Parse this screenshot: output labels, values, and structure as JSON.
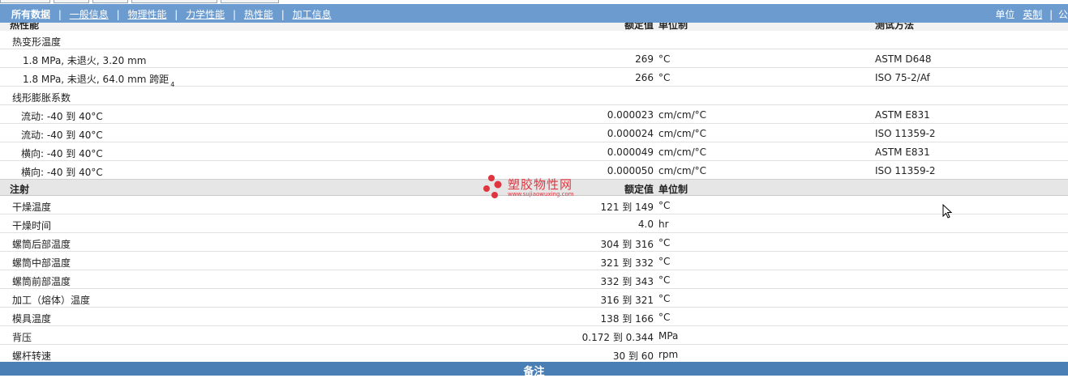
{
  "nav": {
    "all_data": "所有数据",
    "links": [
      "一般信息",
      "物理性能",
      "力学性能",
      "热性能",
      "加工信息"
    ],
    "unit_label": "单位",
    "unit_option": "英制",
    "unit_tail": "公"
  },
  "hidden_header": {
    "name": "热性能",
    "value": "额定值",
    "unit": "单位制",
    "method": "测试方法"
  },
  "thermal_rows": [
    {
      "name": "热变形温度",
      "value": "",
      "unit": "",
      "method": "",
      "level": 0
    },
    {
      "name": "1.8 MPa, 未退火, 3.20 mm",
      "value": "269",
      "unit": "°C",
      "method": "ASTM D648",
      "level": 1
    },
    {
      "name": "1.8 MPa, 未退火, 64.0 mm 跨距",
      "sup": "4",
      "value": "266",
      "unit": "°C",
      "method": "ISO 75-2/Af",
      "level": 1
    },
    {
      "name": "线形膨胀系数",
      "value": "",
      "unit": "",
      "method": "",
      "level": 0
    },
    {
      "name": "流动: -40 到  40°C",
      "value": "0.000023",
      "unit": "cm/cm/°C",
      "method": "ASTM E831",
      "level": 2
    },
    {
      "name": "流动: -40 到  40°C",
      "value": "0.000024",
      "unit": "cm/cm/°C",
      "method": "ISO 11359-2",
      "level": 2
    },
    {
      "name": "横向: -40 到  40°C",
      "value": "0.000049",
      "unit": "cm/cm/°C",
      "method": "ASTM E831",
      "level": 2
    },
    {
      "name": "横向: -40 到  40°C",
      "value": "0.000050",
      "unit": "cm/cm/°C",
      "method": "ISO 11359-2",
      "level": 2
    }
  ],
  "injection_header": {
    "name": "注射",
    "value": "额定值",
    "unit": "单位制"
  },
  "injection_rows": [
    {
      "name": "干燥温度",
      "value": "121 到  149",
      "unit": "°C"
    },
    {
      "name": "干燥时间",
      "value": "4.0",
      "unit": "hr"
    },
    {
      "name": "螺筒后部温度",
      "value": "304 到  316",
      "unit": "°C"
    },
    {
      "name": "螺筒中部温度",
      "value": "321 到  332",
      "unit": "°C"
    },
    {
      "name": "螺筒前部温度",
      "value": "332 到  343",
      "unit": "°C"
    },
    {
      "name": "加工（熔体）温度",
      "value": "316 到  321",
      "unit": "°C"
    },
    {
      "name": "模具温度",
      "value": "138 到  166",
      "unit": "°C"
    },
    {
      "name": "背压",
      "value": "0.172 到  0.344",
      "unit": "MPa"
    },
    {
      "name": "螺杆转速",
      "value": "30 到  60",
      "unit": "rpm"
    }
  ],
  "footer": {
    "label": "备注"
  },
  "watermark": {
    "title": "塑胶物性网",
    "url": "www.sujiaowuxing.com"
  },
  "colors": {
    "navbar": "#6b9bcf",
    "footer": "#4a7fb5",
    "watermark": "#e0353f",
    "section": "#e6e6e6"
  }
}
